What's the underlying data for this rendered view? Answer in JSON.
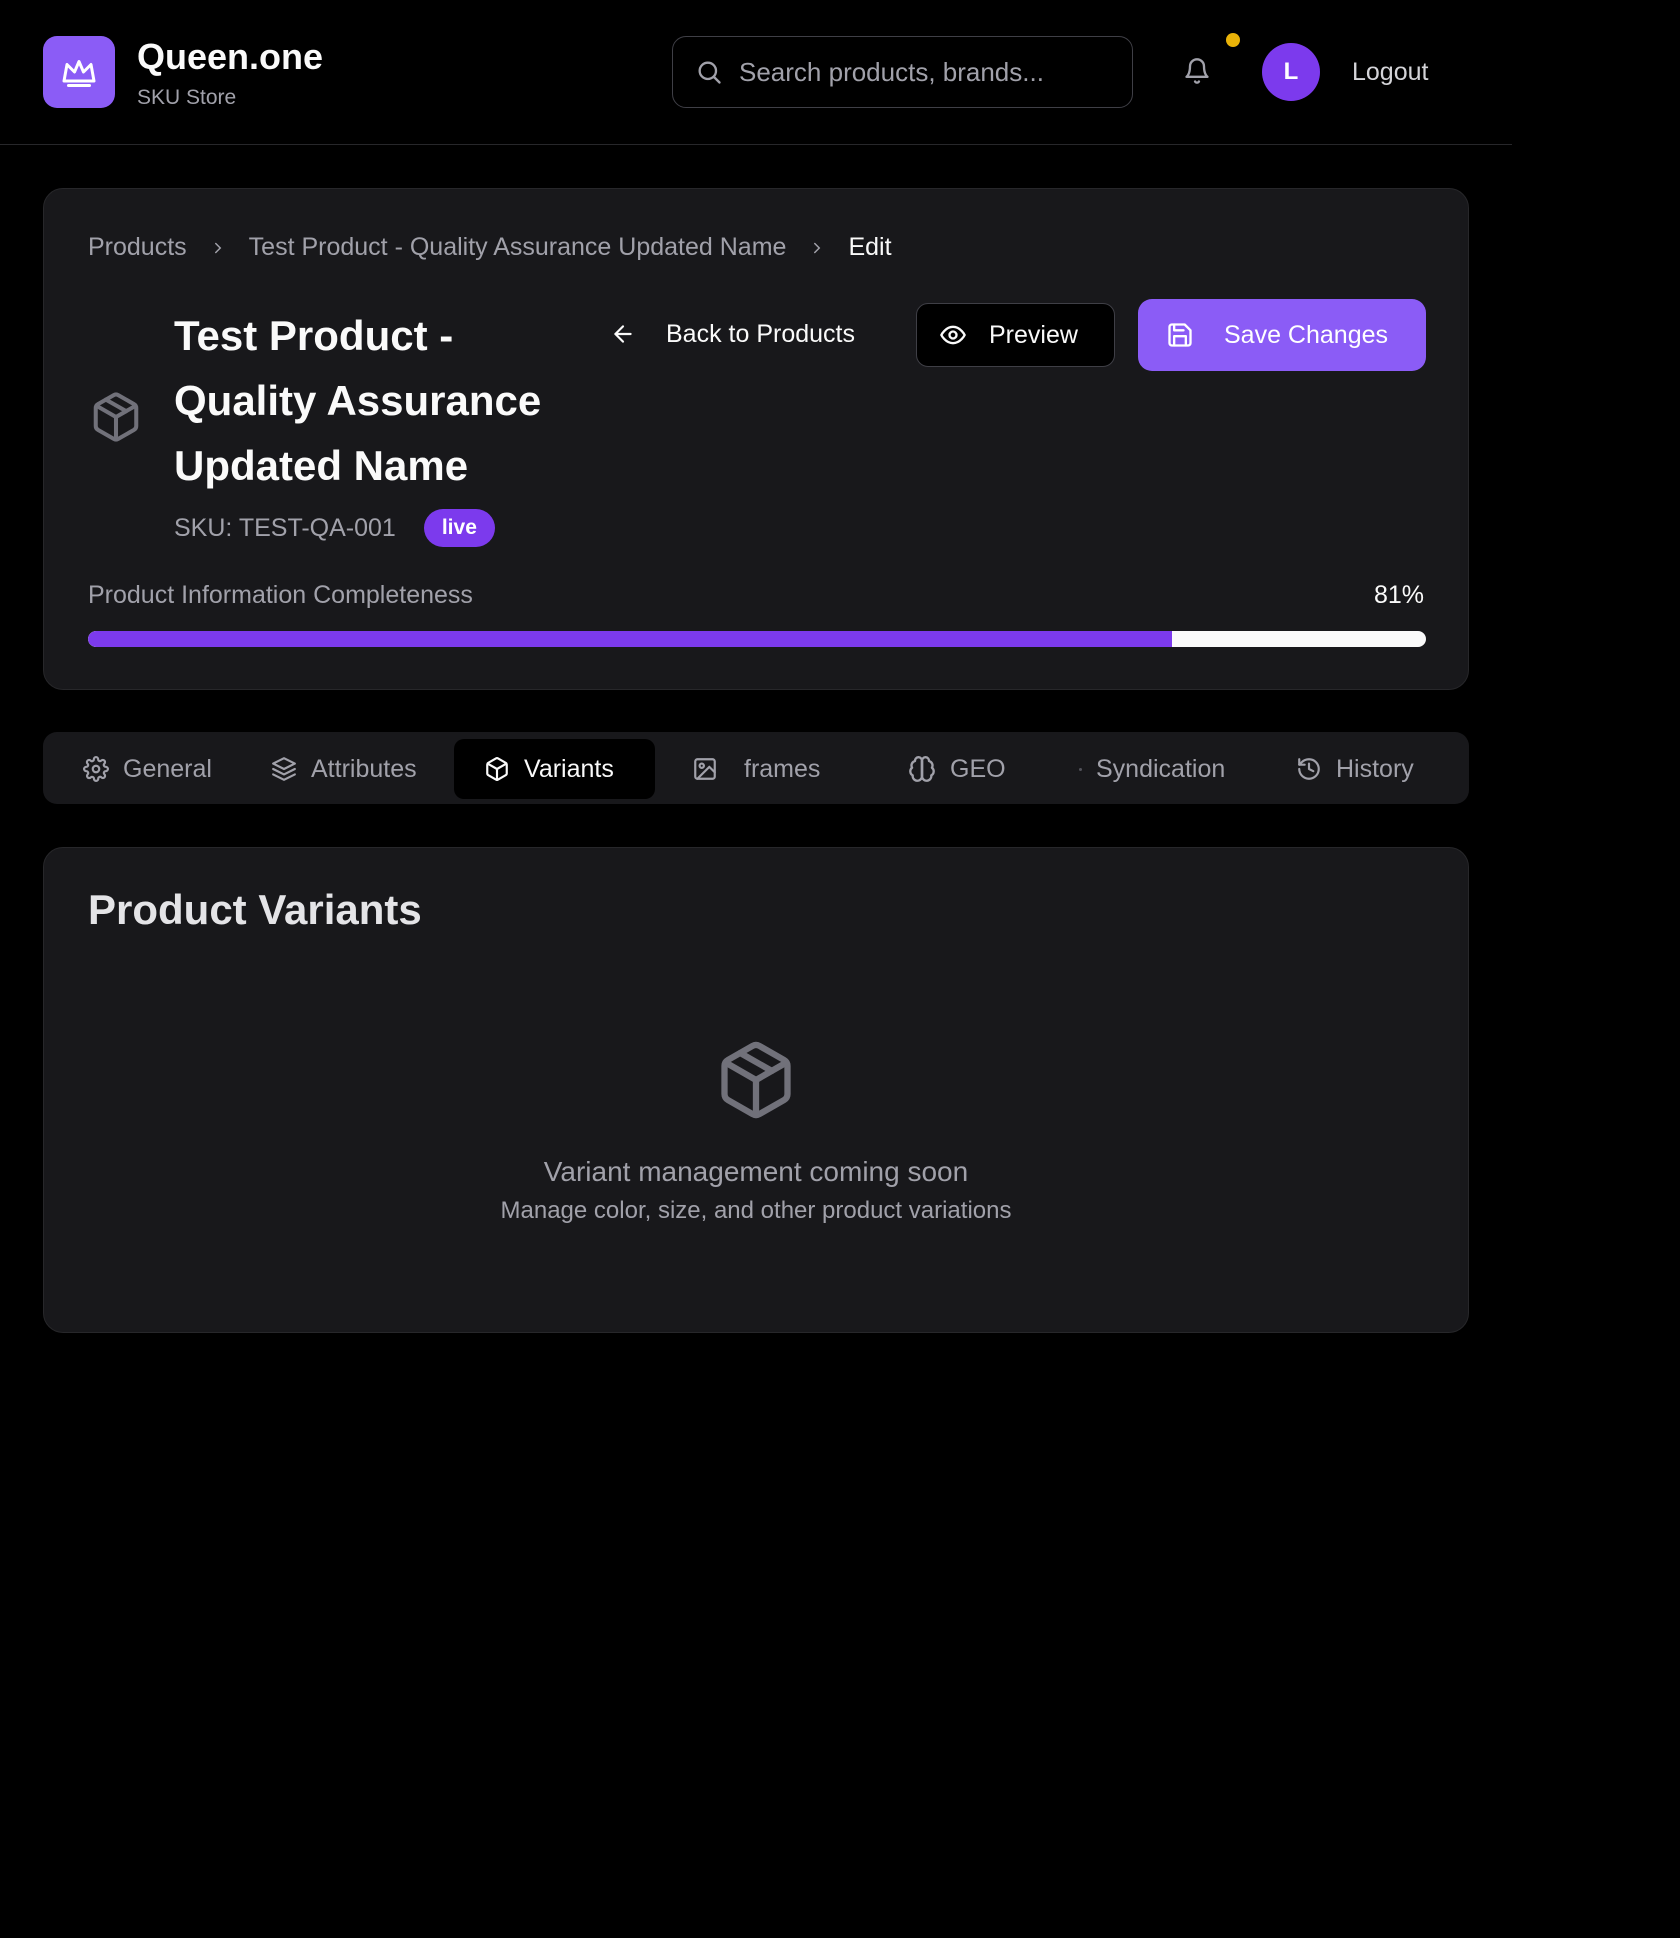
{
  "header": {
    "brand_name": "Queen.one",
    "brand_sub": "SKU Store",
    "search_placeholder": "Search products, brands...",
    "avatar_initial": "L",
    "logout_label": "Logout",
    "notification_dot_color": "#eab308"
  },
  "breadcrumb": {
    "items": [
      "Products",
      "Test Product - Quality Assurance Updated Name",
      "Edit"
    ]
  },
  "product": {
    "title": "Test Product - Quality Assurance Updated Name",
    "sku": "SKU: TEST-QA-001",
    "status": "live"
  },
  "actions": {
    "back_label": "Back to Products",
    "preview_label": "Preview",
    "save_label": "Save Changes"
  },
  "completeness": {
    "label": "Product Information Completeness",
    "percent_label": "81%",
    "value": 0.81
  },
  "tabs": [
    {
      "label": "General",
      "icon": "gear-icon"
    },
    {
      "label": "Attributes",
      "icon": "layers-icon"
    },
    {
      "label": "Variants",
      "icon": "box-icon",
      "active": true
    },
    {
      "label": "frames",
      "icon": "image-icon"
    },
    {
      "label": "GEO",
      "icon": "brain-icon"
    },
    {
      "label": "Syndication",
      "icon": "dot-icon"
    },
    {
      "label": "History",
      "icon": "history-icon"
    }
  ],
  "variants": {
    "title": "Product Variants",
    "empty_title": "Variant management coming soon",
    "empty_sub": "Manage color, size, and other product variations"
  },
  "colors": {
    "accent": "#8b5cf6",
    "accent_dark": "#7c3aed",
    "background": "#000000",
    "card": "#18181b"
  }
}
